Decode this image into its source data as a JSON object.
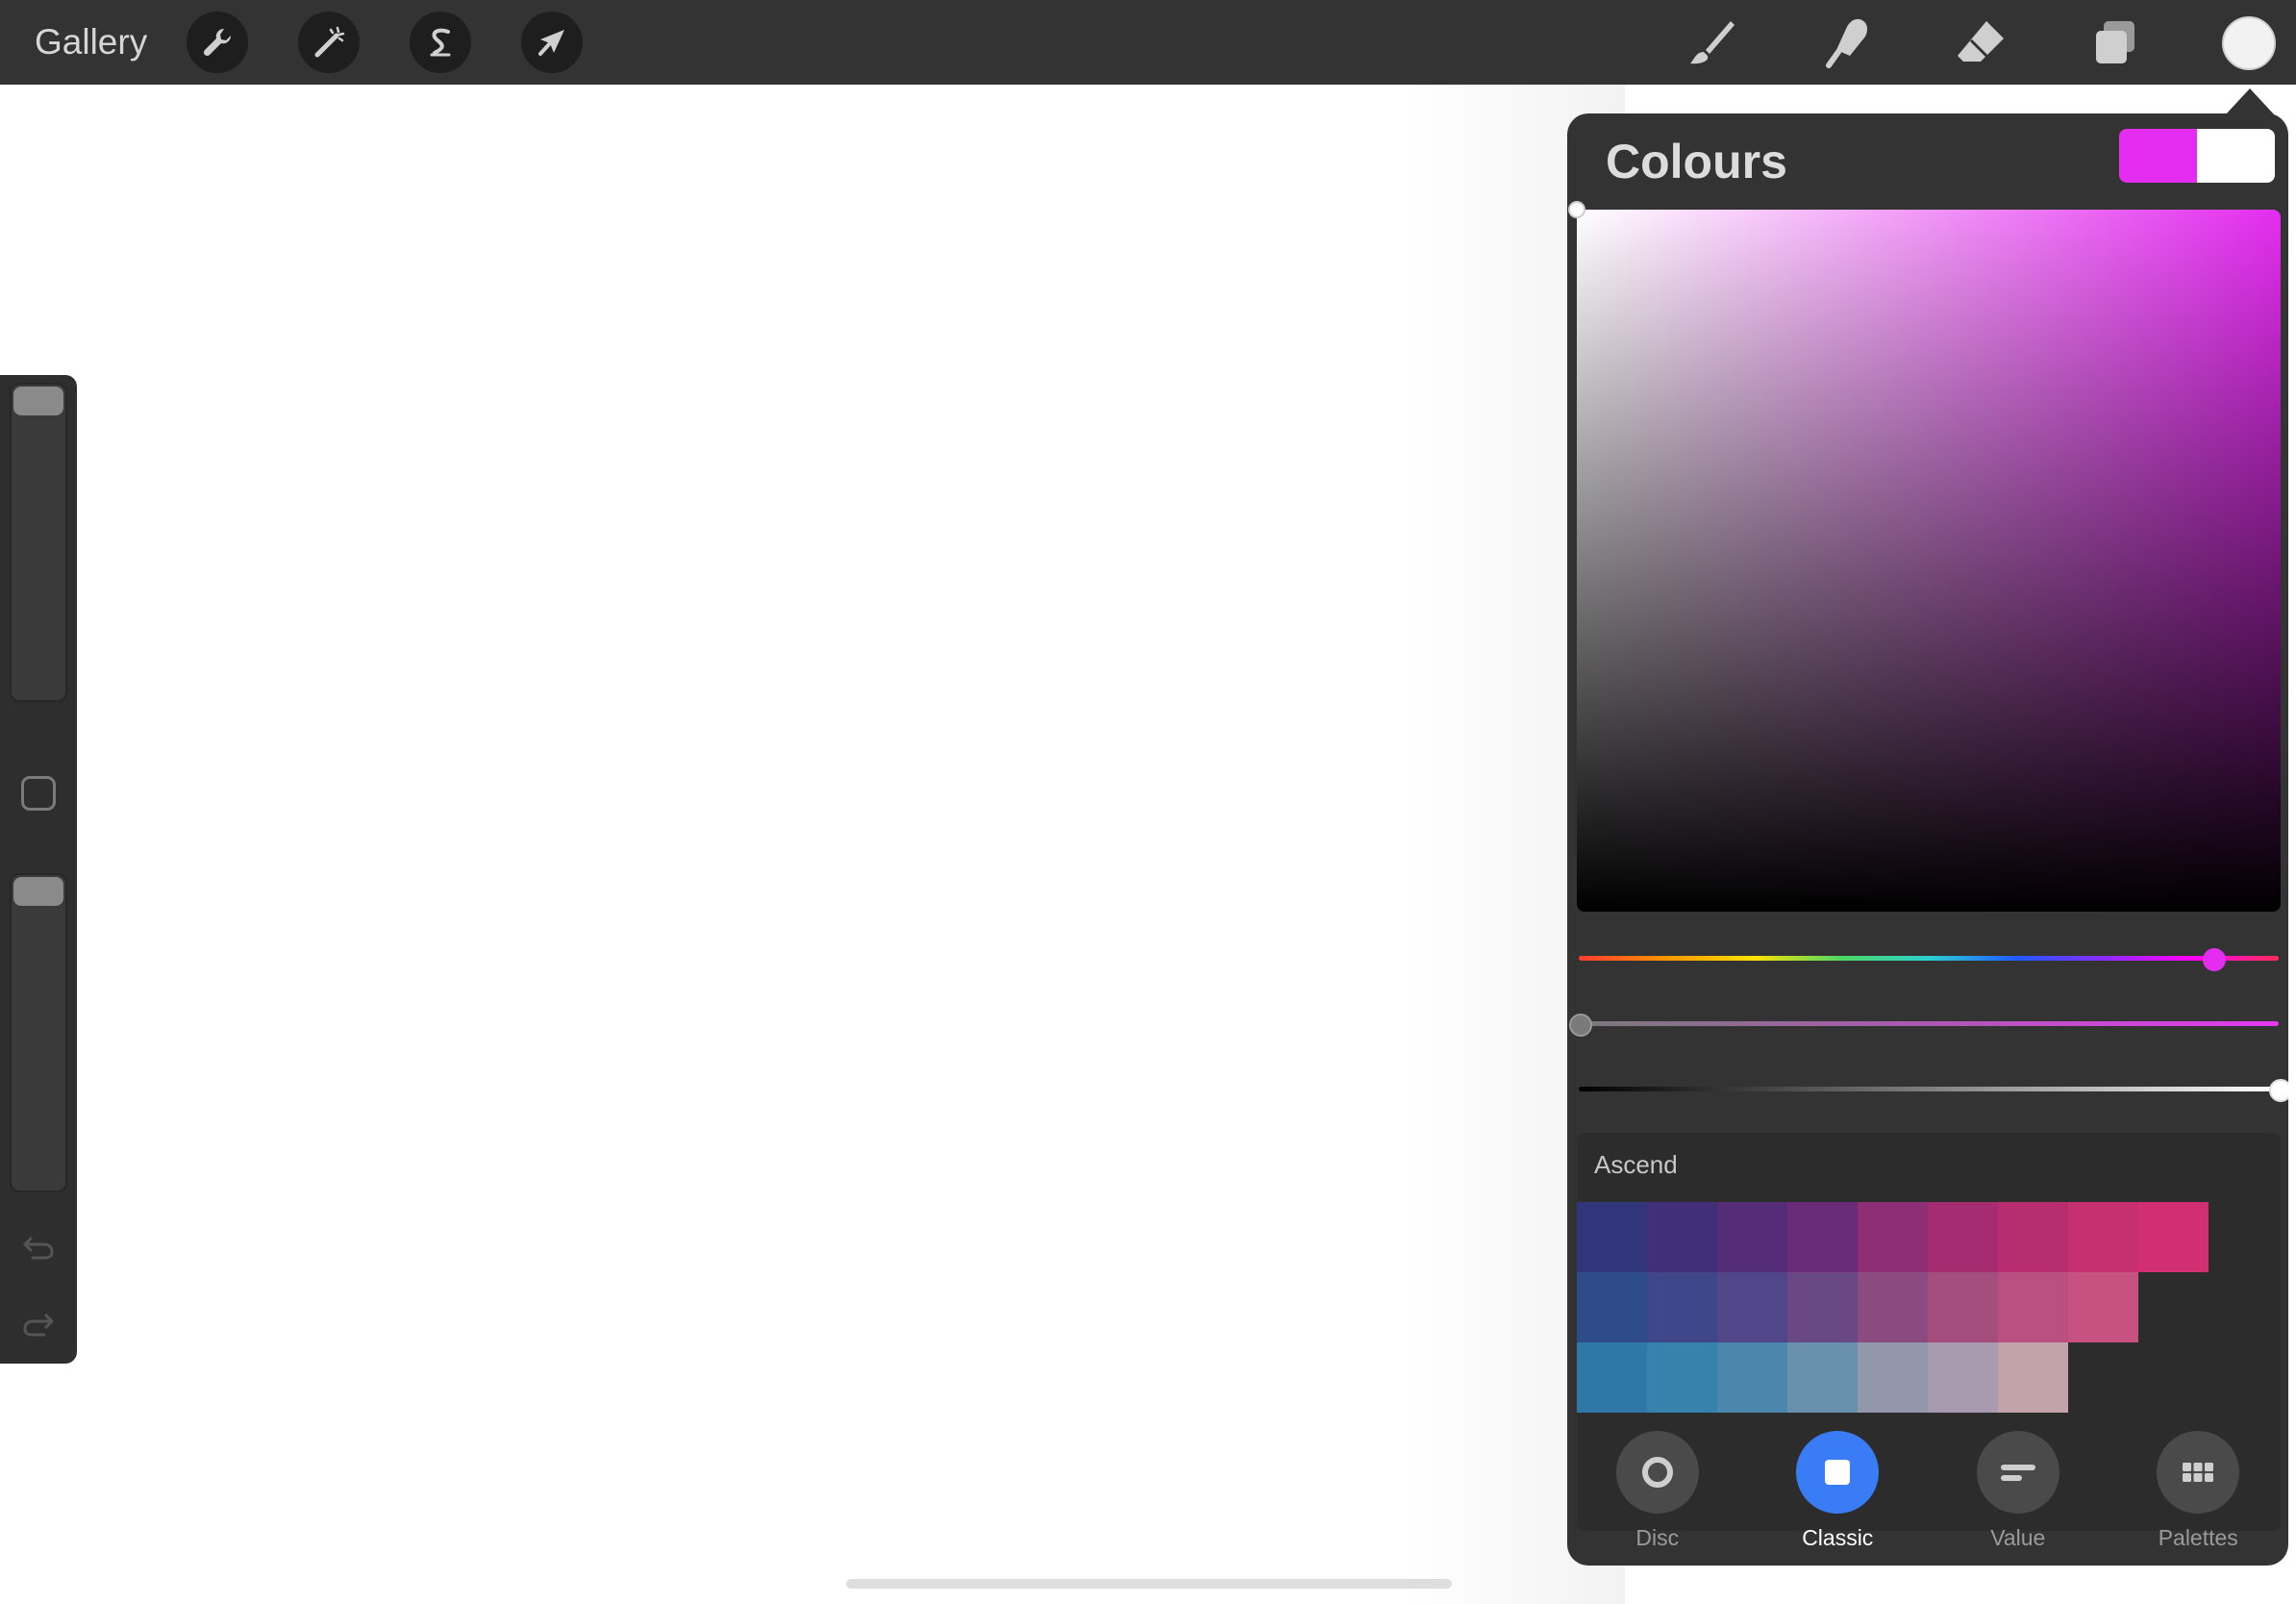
{
  "topbar": {
    "gallery_label": "Gallery",
    "left_tools": [
      {
        "name": "actions",
        "icon": "wrench-icon"
      },
      {
        "name": "adjustments",
        "icon": "magic-wand-icon"
      },
      {
        "name": "selection",
        "icon": "selection-s-icon"
      },
      {
        "name": "transform",
        "icon": "arrow-cursor-icon"
      }
    ],
    "right_tools": [
      {
        "name": "brush",
        "icon": "brush-icon"
      },
      {
        "name": "smudge",
        "icon": "smudge-finger-icon"
      },
      {
        "name": "eraser",
        "icon": "eraser-icon"
      },
      {
        "name": "layers",
        "icon": "layers-icon"
      }
    ],
    "current_color": "#f2f2f2"
  },
  "sidebar": {
    "brush_size_level": 0.0,
    "opacity_level": 0.0
  },
  "colours_panel": {
    "title": "Colours",
    "primary_color": "#e42df0",
    "secondary_color": "#ffffff",
    "hue_color": "#e42df0",
    "hue_level": 0.905,
    "saturation_level": 0.0,
    "brightness_level": 1.0,
    "palette_name": "Ascend",
    "palette_rows": [
      [
        "#31357a",
        "#422f7a",
        "#552c78",
        "#6a2b78",
        "#8e2e74",
        "#a52c70",
        "#b82d6e",
        "#c52f6f",
        "#d12f72"
      ],
      [
        "#2e4c8a",
        "#3f478a",
        "#52468a",
        "#6a4886",
        "#8c4b80",
        "#a44e7e",
        "#b9507f",
        "#c75180"
      ],
      [
        "#2f77a6",
        "#3682ad",
        "#4b87ac",
        "#6890ad",
        "#9397ab",
        "#a89bb0",
        "#c2a3aa"
      ]
    ],
    "tabs": [
      {
        "label": "Disc",
        "icon": "disc-ring-icon",
        "active": false
      },
      {
        "label": "Classic",
        "icon": "square-icon",
        "active": true
      },
      {
        "label": "Value",
        "icon": "value-bars-icon",
        "active": false
      },
      {
        "label": "Palettes",
        "icon": "grid-icon",
        "active": false
      }
    ]
  }
}
